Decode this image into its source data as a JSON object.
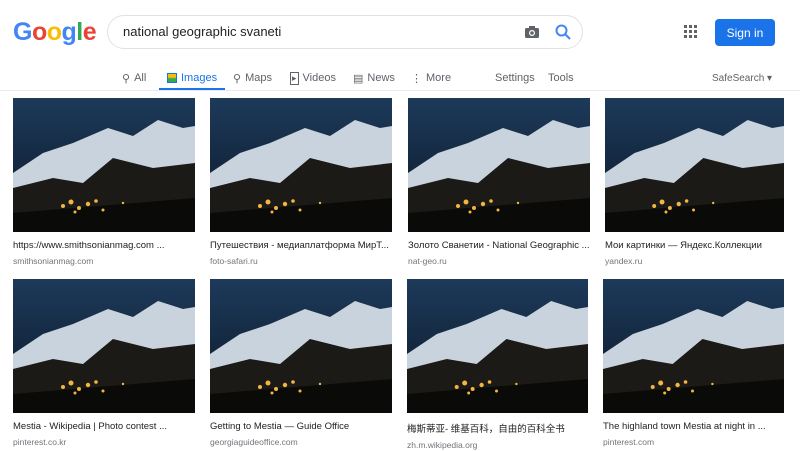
{
  "logo": "Google",
  "search": {
    "query": "national geographic svaneti"
  },
  "header": {
    "sign_in": "Sign in"
  },
  "tabs": [
    {
      "label": "All",
      "icon": "search-icon"
    },
    {
      "label": "Images",
      "icon": "image-icon",
      "active": true
    },
    {
      "label": "Maps",
      "icon": "map-pin-icon"
    },
    {
      "label": "Videos",
      "icon": "play-icon"
    },
    {
      "label": "News",
      "icon": "news-icon"
    },
    {
      "label": "More",
      "icon": "more-vert-icon"
    }
  ],
  "tools": {
    "settings": "Settings",
    "tools": "Tools",
    "safesearch": "SafeSearch ▾"
  },
  "results": [
    {
      "title": "https://www.smithsonianmag.com ...",
      "domain": "smithsonianmag.com"
    },
    {
      "title": "Путешествия - медиаплатформа МирТ...",
      "domain": "foto-safari.ru"
    },
    {
      "title": "Золото Сванетии - National Geographic ...",
      "domain": "nat-geo.ru"
    },
    {
      "title": "Мои картинки — Яндекс.Коллекции",
      "domain": "yandex.ru"
    },
    {
      "title": "Mestia - Wikipedia | Photo contest ...",
      "domain": "pinterest.co.kr"
    },
    {
      "title": "Getting to Mestia — Guide Office",
      "domain": "georgiaguideoffice.com"
    },
    {
      "title": "梅斯蒂亚- 维基百科，自由的百科全书",
      "domain": "zh.m.wikipedia.org"
    },
    {
      "title": "The highland town Mestia at night in ...",
      "domain": "pinterest.com"
    }
  ]
}
